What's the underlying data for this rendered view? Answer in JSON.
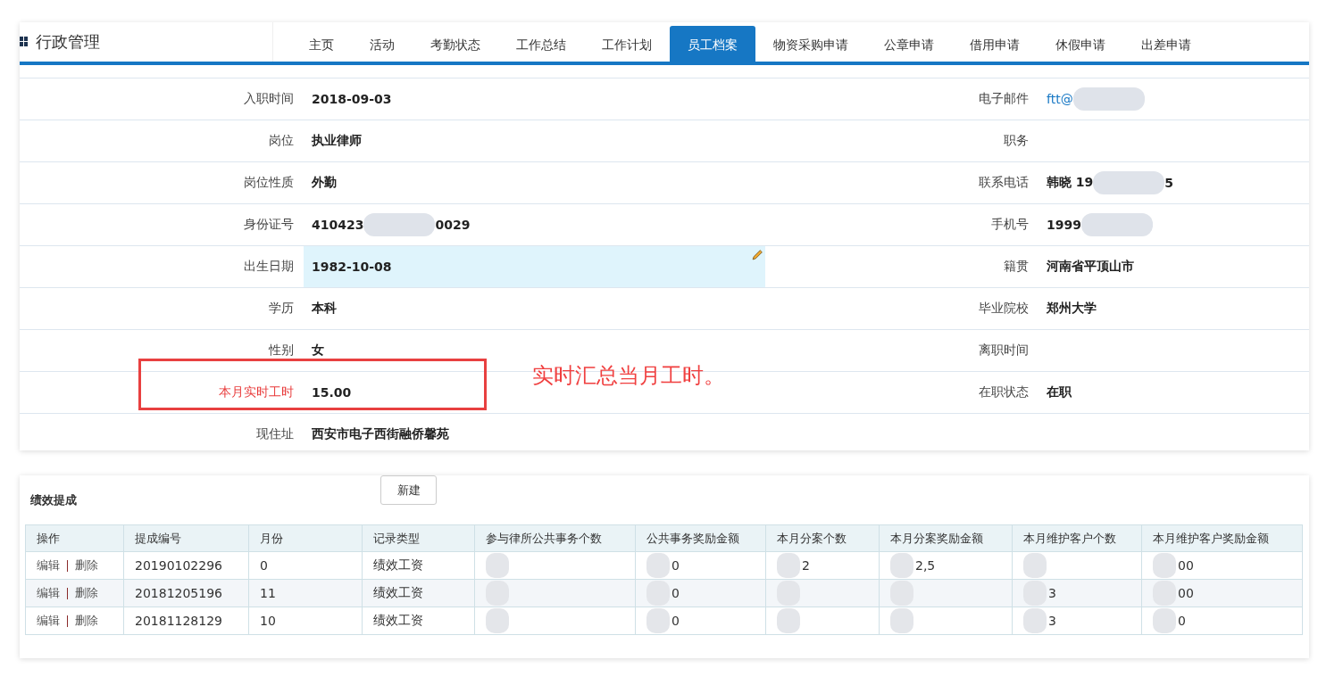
{
  "header": {
    "title": "行政管理"
  },
  "tabs": [
    {
      "label": "主页",
      "selected": false
    },
    {
      "label": "活动",
      "selected": false
    },
    {
      "label": "考勤状态",
      "selected": false
    },
    {
      "label": "工作总结",
      "selected": false
    },
    {
      "label": "工作计划",
      "selected": false
    },
    {
      "label": "员工档案",
      "selected": true
    },
    {
      "label": "物资采购申请",
      "selected": false
    },
    {
      "label": "公章申请",
      "selected": false
    },
    {
      "label": "借用申请",
      "selected": false
    },
    {
      "label": "休假申请",
      "selected": false
    },
    {
      "label": "出差申请",
      "selected": false
    }
  ],
  "profile_rows": [
    {
      "left": {
        "label": "入职时间",
        "value": [
          "2018-09-03"
        ]
      },
      "right": {
        "label": "电子邮件",
        "value": [
          "ftt@"
        ],
        "link": true,
        "redacted": true
      }
    },
    {
      "left": {
        "label": "岗位",
        "value": [
          "执业律师"
        ]
      },
      "right": {
        "label": "职务"
      }
    },
    {
      "left": {
        "label": "岗位性质",
        "value": [
          "外勤"
        ]
      },
      "right": {
        "label": "联系电话",
        "value": [
          "韩晓 19",
          "5"
        ],
        "redacted": true
      }
    },
    {
      "left": {
        "label": "身份证号",
        "value": [
          "410423",
          "0029"
        ]
      },
      "right": {
        "label": "手机号",
        "value": [
          "1999"
        ],
        "redacted": true
      }
    },
    {
      "left": {
        "label": "出生日期",
        "value": [
          "1982-10-08"
        ],
        "highlighted": true
      },
      "right": {
        "label": "籍贯",
        "value": [
          "河南省平顶山市"
        ]
      }
    },
    {
      "left": {
        "label": "学历",
        "value": [
          "本科"
        ]
      },
      "right": {
        "label": "毕业院校",
        "value": [
          "郑州大学"
        ]
      }
    },
    {
      "left": {
        "label": "性别",
        "value": [
          "女"
        ]
      },
      "right": {
        "label": "离职时间"
      }
    },
    {
      "left": {
        "label": "本月实时工时",
        "value": [
          "15.00"
        ],
        "emphasized": true
      },
      "right": {
        "label": "在职状态",
        "value": [
          "在职"
        ]
      }
    },
    {
      "left": {
        "label": "现住址",
        "value": [
          "西安市电子西街融侨馨苑"
        ]
      }
    }
  ],
  "annotation": {
    "text": "实时汇总当月工时。"
  },
  "performance": {
    "title": "绩效提成",
    "new_button": "新建",
    "columns": [
      {
        "label": "操作"
      },
      {
        "label": "提成编号"
      },
      {
        "label": "月份"
      },
      {
        "label": "记录类型"
      },
      {
        "label": "参与律所公共事务个数",
        "redacted": true
      },
      {
        "label": "公共事务奖励金额",
        "redacted": true
      },
      {
        "label": "本月分案个数",
        "redacted": true
      },
      {
        "label": "本月分案奖励金额",
        "redacted": true
      },
      {
        "label": "本月维护客户个数",
        "redacted": true
      },
      {
        "label": "本月维护客户奖励金额",
        "redacted": true
      }
    ],
    "rows": [
      {
        "cells": [
          {
            "kind": "actions",
            "links": [
              "编辑",
              "删除"
            ]
          },
          {
            "kind": "text",
            "text": "20190102296"
          },
          {
            "kind": "text",
            "text": "0"
          },
          {
            "kind": "text",
            "text": "绩效工资"
          },
          {
            "kind": "text"
          },
          {
            "kind": "text",
            "text": "0"
          },
          {
            "kind": "text",
            "text": "2"
          },
          {
            "kind": "text",
            "text": "2,5"
          },
          {
            "kind": "text"
          },
          {
            "kind": "text",
            "text": "00"
          }
        ]
      },
      {
        "cells": [
          {
            "kind": "actions",
            "links": [
              "编辑",
              "删除"
            ]
          },
          {
            "kind": "text",
            "text": "20181205196"
          },
          {
            "kind": "text",
            "text": "11"
          },
          {
            "kind": "text",
            "text": "绩效工资"
          },
          {
            "kind": "text"
          },
          {
            "kind": "text",
            "text": "0"
          },
          {
            "kind": "text"
          },
          {
            "kind": "text"
          },
          {
            "kind": "text",
            "text": "3"
          },
          {
            "kind": "text",
            "text": "00"
          }
        ]
      },
      {
        "cells": [
          {
            "kind": "actions",
            "links": [
              "编辑",
              "删除"
            ]
          },
          {
            "kind": "text",
            "text": "20181128129"
          },
          {
            "kind": "text",
            "text": "10"
          },
          {
            "kind": "text",
            "text": "绩效工资"
          },
          {
            "kind": "text"
          },
          {
            "kind": "text",
            "text": "0"
          },
          {
            "kind": "text"
          },
          {
            "kind": "text"
          },
          {
            "kind": "text",
            "text": "3"
          },
          {
            "kind": "text",
            "text": "0"
          }
        ]
      }
    ]
  }
}
